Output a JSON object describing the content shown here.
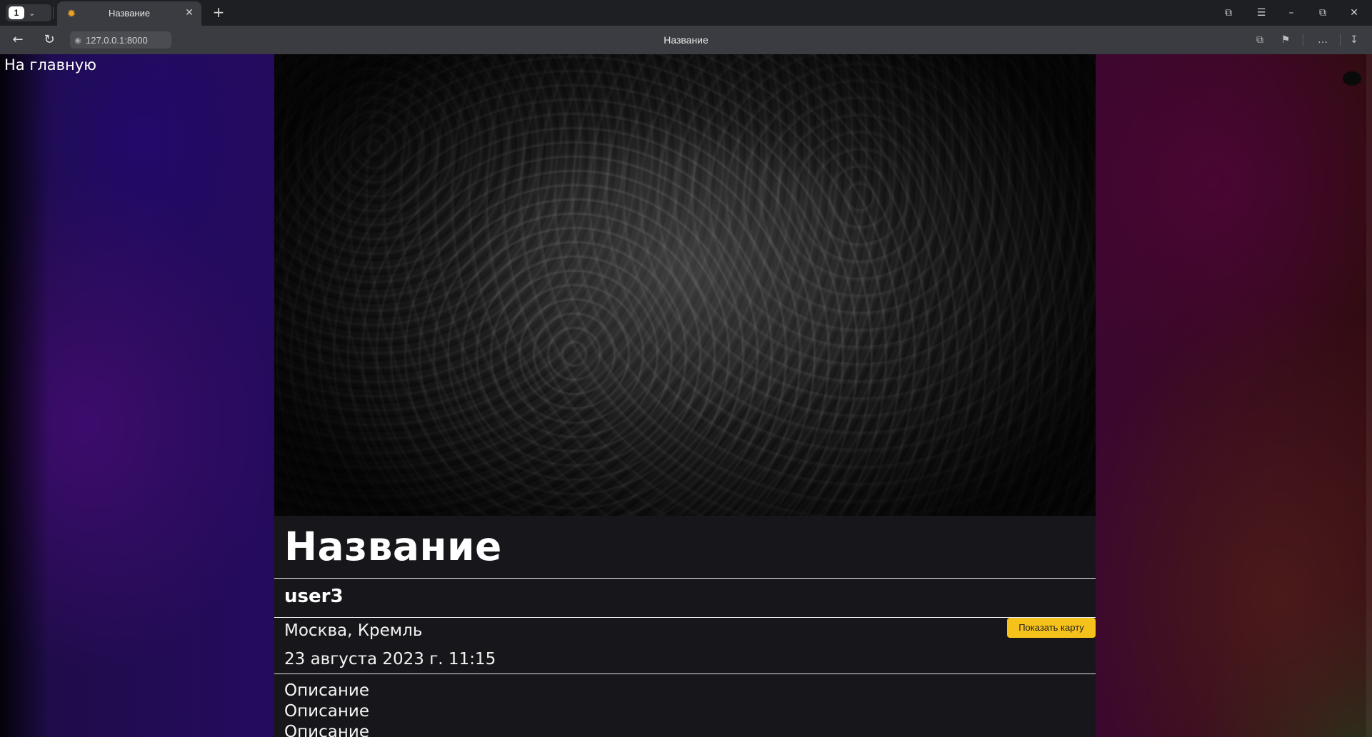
{
  "browser": {
    "tab_count": "1",
    "tab_title": "Название",
    "url": "127.0.0.1:8000",
    "page_title": "Название"
  },
  "page": {
    "home_link": "На главную",
    "title": "Название",
    "author": "user3",
    "location": "Москва, Кремль",
    "datetime": "23 августа 2023 г. 11:15",
    "map_button": "Показать карту",
    "description_lines": [
      "Описание",
      "Описание",
      "Описание"
    ]
  },
  "colors": {
    "accent_button": "#f4c21a",
    "card_background": "#17171b",
    "chrome_background": "#3b3c41"
  },
  "icons": {
    "tab_favicon": "sun-icon",
    "new_tab": "plus-icon",
    "back": "arrow-left-icon",
    "reload": "reload-icon",
    "site_info": "site-info-icon",
    "share": "share-icon",
    "bookmark": "bookmark-icon",
    "more": "more-icon",
    "download": "download-icon"
  }
}
